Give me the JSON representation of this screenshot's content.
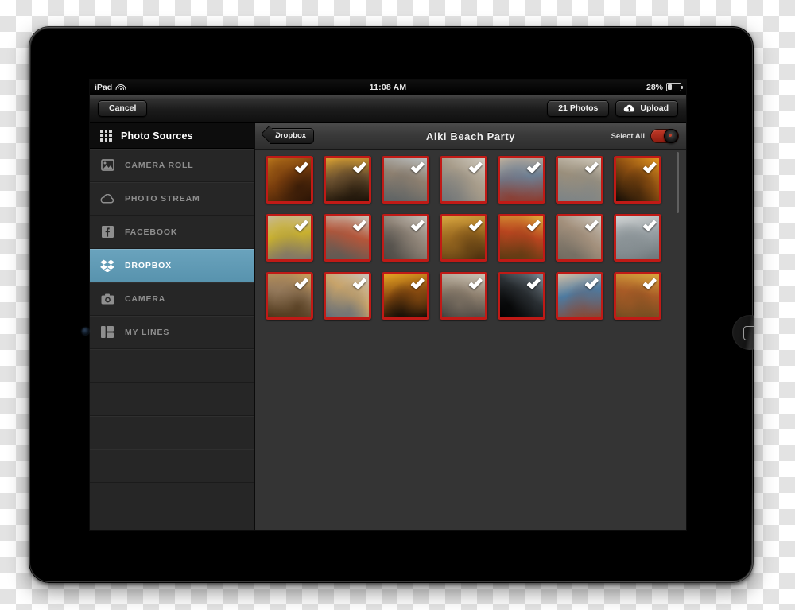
{
  "status_bar": {
    "device": "iPad",
    "wifi_icon": "wifi-icon",
    "time": "11:08 AM",
    "battery_percent": "28%",
    "battery_icon": "battery-icon"
  },
  "toolbar": {
    "cancel_label": "Cancel",
    "photo_count_label": "21 Photos",
    "upload_label": "Upload",
    "upload_icon": "cloud-upload-icon"
  },
  "sidebar": {
    "header_icon": "grid-icon",
    "header_title": "Photo Sources",
    "items": [
      {
        "label": "CAMERA ROLL",
        "icon": "photo-icon",
        "active": false
      },
      {
        "label": "PHOTO STREAM",
        "icon": "cloud-icon",
        "active": false
      },
      {
        "label": "FACEBOOK",
        "icon": "facebook-icon",
        "active": false
      },
      {
        "label": "DROPBOX",
        "icon": "dropbox-icon",
        "active": true
      },
      {
        "label": "CAMERA",
        "icon": "camera-icon",
        "active": false
      },
      {
        "label": "MY LINES",
        "icon": "my-lines-icon",
        "active": false
      }
    ],
    "empty_rows": 4,
    "active_color": "#5e99b4"
  },
  "content": {
    "back_label": "Dropbox",
    "album_title": "Alki Beach Party",
    "select_all_label": "Select All",
    "select_all_on": true,
    "select_all_color": "#a8261a",
    "selection_border_color": "#c01a16",
    "columns": 7,
    "photos": [
      {
        "alt": "heart-hands-sunset",
        "selected": true,
        "c1": "#c9851f",
        "c2": "#2a1406",
        "c3": "#7a3e0d"
      },
      {
        "alt": "couple-walking-beach",
        "selected": true,
        "c1": "#d8a033",
        "c2": "#1b1208",
        "c3": "#6d5230"
      },
      {
        "alt": "friends-sitting-dock",
        "selected": true,
        "c1": "#b9bdbd",
        "c2": "#5c6264",
        "c3": "#8e8070"
      },
      {
        "alt": "group-lying-on-sand",
        "selected": true,
        "c1": "#cfcabf",
        "c2": "#6f7477",
        "c3": "#a79c8a"
      },
      {
        "alt": "friends-playing-sand",
        "selected": true,
        "c1": "#c2b19c",
        "c2": "#8c3a2d",
        "c3": "#6d7f93"
      },
      {
        "alt": "beach-crowd-standing",
        "selected": true,
        "c1": "#cdc6b8",
        "c2": "#7b8387",
        "c3": "#9a8f7c"
      },
      {
        "alt": "silhouettes-dancing-sunset",
        "selected": true,
        "c1": "#e0941f",
        "c2": "#120c06",
        "c3": "#8d4f11"
      },
      {
        "alt": "women-sitting-sand",
        "selected": true,
        "c1": "#c8bba8",
        "c2": "#7d736a",
        "c3": "#c8b02f"
      },
      {
        "alt": "couple-dancing-beach",
        "selected": true,
        "c1": "#cac4b7",
        "c2": "#5e5a55",
        "c3": "#b4563a"
      },
      {
        "alt": "friends-hugging-sunglasses",
        "selected": true,
        "c1": "#c5bfb6",
        "c2": "#4a4844",
        "c3": "#8d8276"
      },
      {
        "alt": "crowd-walking-golden-hour",
        "selected": true,
        "c1": "#d8a63f",
        "c2": "#4b2f0e",
        "c3": "#9b6a20"
      },
      {
        "alt": "crowd-cheering-sunset",
        "selected": true,
        "c1": "#dfa738",
        "c2": "#5a3a12",
        "c3": "#b8451f"
      },
      {
        "alt": "couple-jumping-shore",
        "selected": true,
        "c1": "#cdc9c0",
        "c2": "#6f6a60",
        "c3": "#a3907c"
      },
      {
        "alt": "friends-with-surfboard",
        "selected": true,
        "c1": "#cfd2d2",
        "c2": "#6d7679",
        "c3": "#98a0a4"
      },
      {
        "alt": "dancing-on-shoreline",
        "selected": true,
        "c1": "#c79a58",
        "c2": "#4b3418",
        "c3": "#93785a"
      },
      {
        "alt": "couple-laughing-sand",
        "selected": true,
        "c1": "#cbc3b8",
        "c2": "#5e6a78",
        "c3": "#c7a36a"
      },
      {
        "alt": "silhouettes-jumping-sunset",
        "selected": true,
        "c1": "#e6a423",
        "c2": "#0a0805",
        "c3": "#8a4c10"
      },
      {
        "alt": "two-friends-sunglasses",
        "selected": true,
        "c1": "#cac2b3",
        "c2": "#3c3a38",
        "c3": "#8d7f6e"
      },
      {
        "alt": "party-silhouette-dark",
        "selected": true,
        "c1": "#7d8a94",
        "c2": "#000000",
        "c3": "#2a2f33"
      },
      {
        "alt": "beach-games-balloons",
        "selected": true,
        "c1": "#cdbda6",
        "c2": "#8b4630",
        "c3": "#4d7aa0"
      },
      {
        "alt": "group-jumping-celebration",
        "selected": true,
        "c1": "#d8a33c",
        "c2": "#6a4a20",
        "c3": "#a85b26"
      }
    ]
  },
  "hardware": {
    "camera_icon": "front-camera-lens",
    "home_button": "home-button"
  }
}
